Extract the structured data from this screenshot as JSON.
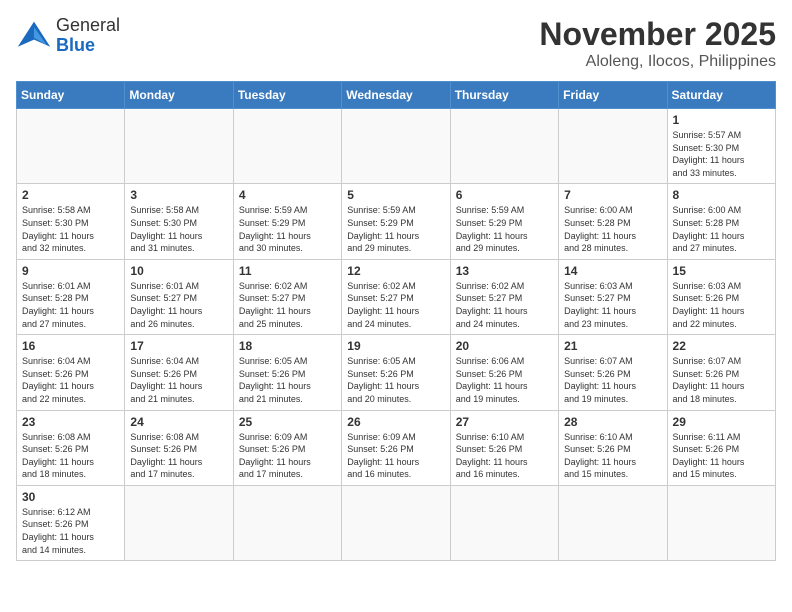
{
  "header": {
    "logo_general": "General",
    "logo_blue": "Blue",
    "month": "November 2025",
    "location": "Aloleng, Ilocos, Philippines"
  },
  "weekdays": [
    "Sunday",
    "Monday",
    "Tuesday",
    "Wednesday",
    "Thursday",
    "Friday",
    "Saturday"
  ],
  "weeks": [
    [
      {
        "day": "",
        "info": ""
      },
      {
        "day": "",
        "info": ""
      },
      {
        "day": "",
        "info": ""
      },
      {
        "day": "",
        "info": ""
      },
      {
        "day": "",
        "info": ""
      },
      {
        "day": "",
        "info": ""
      },
      {
        "day": "1",
        "info": "Sunrise: 5:57 AM\nSunset: 5:30 PM\nDaylight: 11 hours\nand 33 minutes."
      }
    ],
    [
      {
        "day": "2",
        "info": "Sunrise: 5:58 AM\nSunset: 5:30 PM\nDaylight: 11 hours\nand 32 minutes."
      },
      {
        "day": "3",
        "info": "Sunrise: 5:58 AM\nSunset: 5:30 PM\nDaylight: 11 hours\nand 31 minutes."
      },
      {
        "day": "4",
        "info": "Sunrise: 5:59 AM\nSunset: 5:29 PM\nDaylight: 11 hours\nand 30 minutes."
      },
      {
        "day": "5",
        "info": "Sunrise: 5:59 AM\nSunset: 5:29 PM\nDaylight: 11 hours\nand 29 minutes."
      },
      {
        "day": "6",
        "info": "Sunrise: 5:59 AM\nSunset: 5:29 PM\nDaylight: 11 hours\nand 29 minutes."
      },
      {
        "day": "7",
        "info": "Sunrise: 6:00 AM\nSunset: 5:28 PM\nDaylight: 11 hours\nand 28 minutes."
      },
      {
        "day": "8",
        "info": "Sunrise: 6:00 AM\nSunset: 5:28 PM\nDaylight: 11 hours\nand 27 minutes."
      }
    ],
    [
      {
        "day": "9",
        "info": "Sunrise: 6:01 AM\nSunset: 5:28 PM\nDaylight: 11 hours\nand 27 minutes."
      },
      {
        "day": "10",
        "info": "Sunrise: 6:01 AM\nSunset: 5:27 PM\nDaylight: 11 hours\nand 26 minutes."
      },
      {
        "day": "11",
        "info": "Sunrise: 6:02 AM\nSunset: 5:27 PM\nDaylight: 11 hours\nand 25 minutes."
      },
      {
        "day": "12",
        "info": "Sunrise: 6:02 AM\nSunset: 5:27 PM\nDaylight: 11 hours\nand 24 minutes."
      },
      {
        "day": "13",
        "info": "Sunrise: 6:02 AM\nSunset: 5:27 PM\nDaylight: 11 hours\nand 24 minutes."
      },
      {
        "day": "14",
        "info": "Sunrise: 6:03 AM\nSunset: 5:27 PM\nDaylight: 11 hours\nand 23 minutes."
      },
      {
        "day": "15",
        "info": "Sunrise: 6:03 AM\nSunset: 5:26 PM\nDaylight: 11 hours\nand 22 minutes."
      }
    ],
    [
      {
        "day": "16",
        "info": "Sunrise: 6:04 AM\nSunset: 5:26 PM\nDaylight: 11 hours\nand 22 minutes."
      },
      {
        "day": "17",
        "info": "Sunrise: 6:04 AM\nSunset: 5:26 PM\nDaylight: 11 hours\nand 21 minutes."
      },
      {
        "day": "18",
        "info": "Sunrise: 6:05 AM\nSunset: 5:26 PM\nDaylight: 11 hours\nand 21 minutes."
      },
      {
        "day": "19",
        "info": "Sunrise: 6:05 AM\nSunset: 5:26 PM\nDaylight: 11 hours\nand 20 minutes."
      },
      {
        "day": "20",
        "info": "Sunrise: 6:06 AM\nSunset: 5:26 PM\nDaylight: 11 hours\nand 19 minutes."
      },
      {
        "day": "21",
        "info": "Sunrise: 6:07 AM\nSunset: 5:26 PM\nDaylight: 11 hours\nand 19 minutes."
      },
      {
        "day": "22",
        "info": "Sunrise: 6:07 AM\nSunset: 5:26 PM\nDaylight: 11 hours\nand 18 minutes."
      }
    ],
    [
      {
        "day": "23",
        "info": "Sunrise: 6:08 AM\nSunset: 5:26 PM\nDaylight: 11 hours\nand 18 minutes."
      },
      {
        "day": "24",
        "info": "Sunrise: 6:08 AM\nSunset: 5:26 PM\nDaylight: 11 hours\nand 17 minutes."
      },
      {
        "day": "25",
        "info": "Sunrise: 6:09 AM\nSunset: 5:26 PM\nDaylight: 11 hours\nand 17 minutes."
      },
      {
        "day": "26",
        "info": "Sunrise: 6:09 AM\nSunset: 5:26 PM\nDaylight: 11 hours\nand 16 minutes."
      },
      {
        "day": "27",
        "info": "Sunrise: 6:10 AM\nSunset: 5:26 PM\nDaylight: 11 hours\nand 16 minutes."
      },
      {
        "day": "28",
        "info": "Sunrise: 6:10 AM\nSunset: 5:26 PM\nDaylight: 11 hours\nand 15 minutes."
      },
      {
        "day": "29",
        "info": "Sunrise: 6:11 AM\nSunset: 5:26 PM\nDaylight: 11 hours\nand 15 minutes."
      }
    ],
    [
      {
        "day": "30",
        "info": "Sunrise: 6:12 AM\nSunset: 5:26 PM\nDaylight: 11 hours\nand 14 minutes."
      },
      {
        "day": "",
        "info": ""
      },
      {
        "day": "",
        "info": ""
      },
      {
        "day": "",
        "info": ""
      },
      {
        "day": "",
        "info": ""
      },
      {
        "day": "",
        "info": ""
      },
      {
        "day": "",
        "info": ""
      }
    ]
  ]
}
